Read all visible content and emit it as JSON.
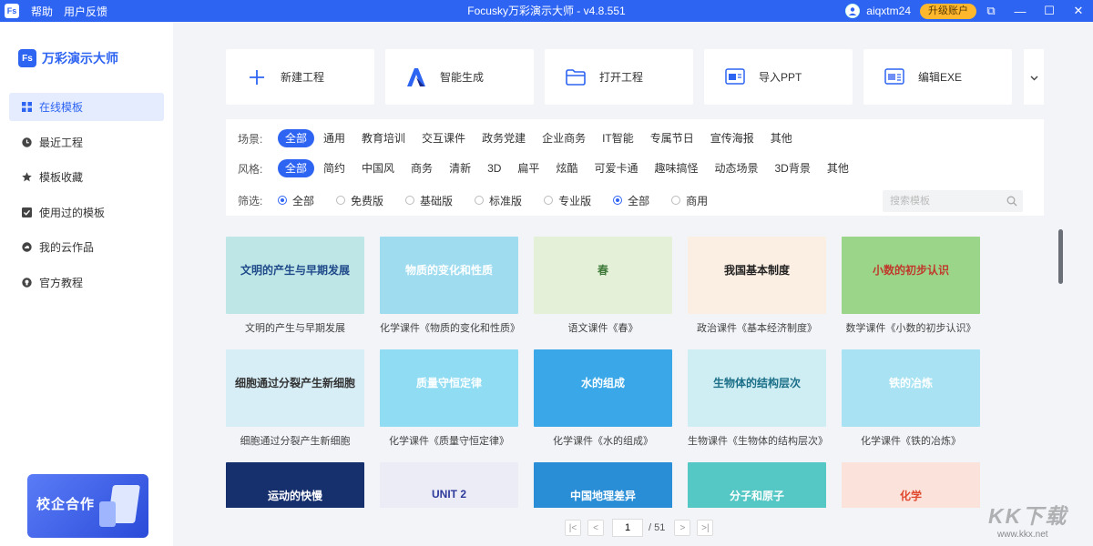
{
  "titlebar": {
    "logo": "Fs",
    "menu": [
      "帮助",
      "用户反馈"
    ],
    "title": "Focusky万彩演示大师 - v4.8.551",
    "username": "aiqxtm24",
    "upgrade_label": "升级账户",
    "controls": {
      "restore": "⧉",
      "minimize": "—",
      "maximize": "☐",
      "close": "✕"
    }
  },
  "sidebar": {
    "brand": "万彩演示大师",
    "brand_logo": "Fs",
    "items": [
      {
        "label": "在线模板",
        "icon": "grid-icon",
        "active": true
      },
      {
        "label": "最近工程",
        "icon": "clock-icon"
      },
      {
        "label": "模板收藏",
        "icon": "star-icon"
      },
      {
        "label": "使用过的模板",
        "icon": "check-box-icon"
      },
      {
        "label": "我的云作品",
        "icon": "cloud-icon"
      },
      {
        "label": "官方教程",
        "icon": "lightbulb-icon"
      }
    ],
    "promo": "校企合作"
  },
  "actions": [
    {
      "label": "新建工程",
      "icon": "plus-icon"
    },
    {
      "label": "智能生成",
      "icon": "ai-logo-icon"
    },
    {
      "label": "打开工程",
      "icon": "folder-icon"
    },
    {
      "label": "导入PPT",
      "icon": "ppt-import-icon"
    },
    {
      "label": "编辑EXE",
      "icon": "exe-edit-icon"
    }
  ],
  "filters": {
    "scene_label": "场景:",
    "scenes": [
      "全部",
      "通用",
      "教育培训",
      "交互课件",
      "政务党建",
      "企业商务",
      "IT智能",
      "专属节日",
      "宣传海报",
      "其他"
    ],
    "style_label": "风格:",
    "styles": [
      "全部",
      "简约",
      "中国风",
      "商务",
      "清新",
      "3D",
      "扁平",
      "炫酷",
      "可爱卡通",
      "趣味搞怪",
      "动态场景",
      "3D背景",
      "其他"
    ],
    "screen_label": "筛选:",
    "versions": [
      "全部",
      "免费版",
      "基础版",
      "标准版",
      "专业版"
    ],
    "usage": [
      "全部",
      "商用"
    ],
    "search_placeholder": "搜索模板"
  },
  "templates": [
    {
      "title": "文明的产生与早期发展",
      "thumb_text": "文明的产生与早期发展",
      "bg": "#bfe6e6",
      "fg": "#1f4a8a"
    },
    {
      "title": "化学课件《物质的变化和性质》",
      "thumb_text": "物质的变化和性质",
      "bg": "#9fdcf0",
      "fg": "#ffffff"
    },
    {
      "title": "语文课件《春》",
      "thumb_text": "春",
      "bg": "#e4f1d8",
      "fg": "#3f7a3a"
    },
    {
      "title": "政治课件《基本经济制度》",
      "thumb_text": "我国基本制度",
      "bg": "#fbeee3",
      "fg": "#222222"
    },
    {
      "title": "数学课件《小数的初步认识》",
      "thumb_text": "小数的初步认识",
      "bg": "#9ad58a",
      "fg": "#c0392b"
    },
    {
      "title": "细胞通过分裂产生新细胞",
      "thumb_text": "细胞通过分裂产生新细胞",
      "bg": "#d7eef7",
      "fg": "#333333"
    },
    {
      "title": "化学课件《质量守恒定律》",
      "thumb_text": "质量守恒定律",
      "bg": "#8fdcf3",
      "fg": "#ffffff"
    },
    {
      "title": "化学课件《水的组成》",
      "thumb_text": "水的组成",
      "bg": "#3aa8e8",
      "fg": "#ffffff"
    },
    {
      "title": "生物课件《生物体的结构层次》",
      "thumb_text": "生物体的结构层次",
      "bg": "#cfeef3",
      "fg": "#1b6f88"
    },
    {
      "title": "化学课件《铁的冶炼》",
      "thumb_text": "铁的冶炼",
      "bg": "#a9e3f3",
      "fg": "#ffffff"
    },
    {
      "title": "",
      "thumb_text": "运动的快慢",
      "bg": "#16306e",
      "fg": "#ffffff"
    },
    {
      "title": "",
      "thumb_text": "UNIT 2",
      "bg": "#ececf7",
      "fg": "#2e3a9a"
    },
    {
      "title": "",
      "thumb_text": "中国地理差异",
      "bg": "#2a8ed6",
      "fg": "#ffffff"
    },
    {
      "title": "",
      "thumb_text": "分子和原子",
      "bg": "#55c7c4",
      "fg": "#ffffff"
    },
    {
      "title": "",
      "thumb_text": "化学",
      "bg": "#fbe3dc",
      "fg": "#e0482e"
    }
  ],
  "pagination": {
    "first": "|<",
    "prev": "<",
    "current": "1",
    "total": "/ 51",
    "next": ">",
    "last": ">|"
  },
  "watermark": {
    "big": "KK下载",
    "small": "www.kkx.net"
  }
}
